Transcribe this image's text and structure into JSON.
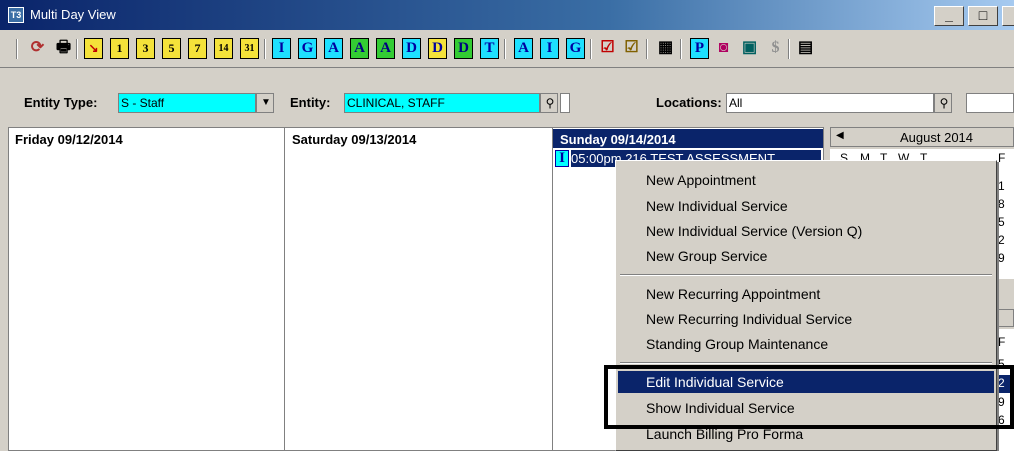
{
  "window": {
    "title": "Multi Day View",
    "icon_text": "T3",
    "minimize": "_",
    "maximize": "□"
  },
  "toolbar": {
    "refresh": "⟳",
    "print": "🖶",
    "day_buttons": [
      "1",
      "3",
      "5",
      "7",
      "14",
      "31"
    ],
    "letters1": [
      "I",
      "G",
      "A",
      "A",
      "A",
      "D",
      "D",
      "D",
      "T"
    ],
    "letters2": [
      "A",
      "I",
      "G"
    ],
    "checks": [
      "☑",
      "☑"
    ],
    "misc": [
      "▦",
      "P",
      "◙",
      "▣",
      "$",
      "▤"
    ]
  },
  "filters": {
    "entity_type_label": "Entity Type:",
    "entity_type_value": "S - Staff",
    "entity_label": "Entity:",
    "entity_value": "CLINICAL, STAFF",
    "locations_label": "Locations:",
    "locations_value": "All"
  },
  "days": [
    {
      "header": "Friday 09/12/2014"
    },
    {
      "header": "Saturday 09/13/2014"
    },
    {
      "header": "Sunday 09/14/2014"
    }
  ],
  "appointment": {
    "icon": "I",
    "text": "05:00pm 216  TEST ASSESSMENT"
  },
  "minical": {
    "month": "August 2014",
    "weekdays": [
      "S",
      "M",
      "T",
      "W",
      "T",
      "F"
    ],
    "col_f_top": [
      "1",
      "8",
      "5",
      "2",
      "9"
    ],
    "col_f_bottom_hdr": "F",
    "col_f_bottom": [
      "5",
      "2",
      "9",
      "6"
    ]
  },
  "menu": {
    "items_group1": [
      "New Appointment",
      "New Individual Service",
      "New Individual Service (Version Q)",
      "New Group Service"
    ],
    "items_group2": [
      "New Recurring Appointment",
      "New Recurring Individual Service",
      "Standing Group Maintenance"
    ],
    "items_group3": [
      "Edit Individual Service",
      "Show Individual Service",
      "Launch Billing Pro Forma"
    ],
    "selected": "Edit Individual Service"
  },
  "colors": {
    "highlight": "#0a246a",
    "entity_bg": "#00ffff",
    "toolbar_yellow": "#f4e23a"
  }
}
